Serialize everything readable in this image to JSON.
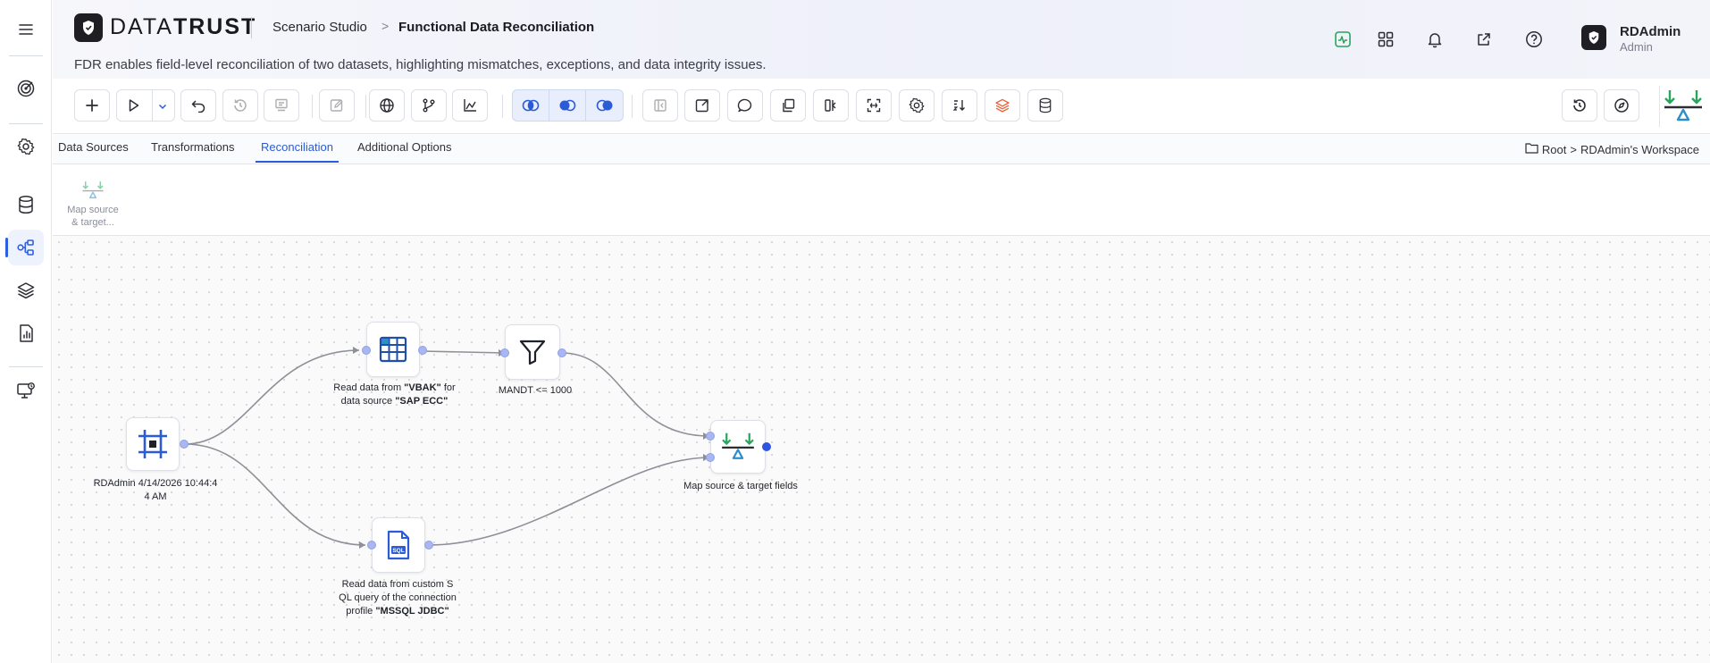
{
  "app": {
    "brand_light": "DATA",
    "brand_bold": "TRUST"
  },
  "breadcrumb": {
    "studio": "Scenario Studio",
    "separator": ">",
    "page": "Functional Data Reconciliation"
  },
  "description": "FDR enables field-level reconciliation of two datasets, highlighting mismatches, exceptions, and data integrity issues.",
  "user": {
    "name": "RDAdmin",
    "role": "Admin"
  },
  "sidebar": {
    "items": [
      {
        "name": "menu-icon"
      },
      {
        "name": "target-icon"
      },
      {
        "name": "settings-icon"
      },
      {
        "name": "database-icon"
      },
      {
        "name": "workflow-icon",
        "active": true
      },
      {
        "name": "layers-icon"
      },
      {
        "name": "report-icon"
      },
      {
        "name": "monitor-icon"
      }
    ]
  },
  "tabs": [
    {
      "label": "Data Sources"
    },
    {
      "label": "Transformations"
    },
    {
      "label": "Reconciliation",
      "active": true
    },
    {
      "label": "Additional Options"
    }
  ],
  "workspace": {
    "root": "Root",
    "separator": ">",
    "name": "RDAdmin's Workspace"
  },
  "palette": {
    "item_label_line1": "Map source",
    "item_label_line2": "& target..."
  },
  "nodes": {
    "start": {
      "label_line1": "RDAdmin 4/14/2026 10:44:4",
      "label_line2": "4 AM"
    },
    "sap": {
      "pre1": "Read data from ",
      "bold1": "\"VBAK\"",
      "post1": " for",
      "pre2": "data source ",
      "bold2": "\"SAP ECC\""
    },
    "filter": {
      "label": "MANDT <= 1000"
    },
    "sql": {
      "line1": "Read data from custom S",
      "line2": "QL query of the connection",
      "pre3": "profile ",
      "bold3": "\"MSSQL JDBC\""
    },
    "map": {
      "label": "Map source & target fields"
    }
  },
  "colors": {
    "accent": "#2b5bd7",
    "green": "#27a55b",
    "teal": "#2d8fc9",
    "edge": "#8e9098"
  }
}
